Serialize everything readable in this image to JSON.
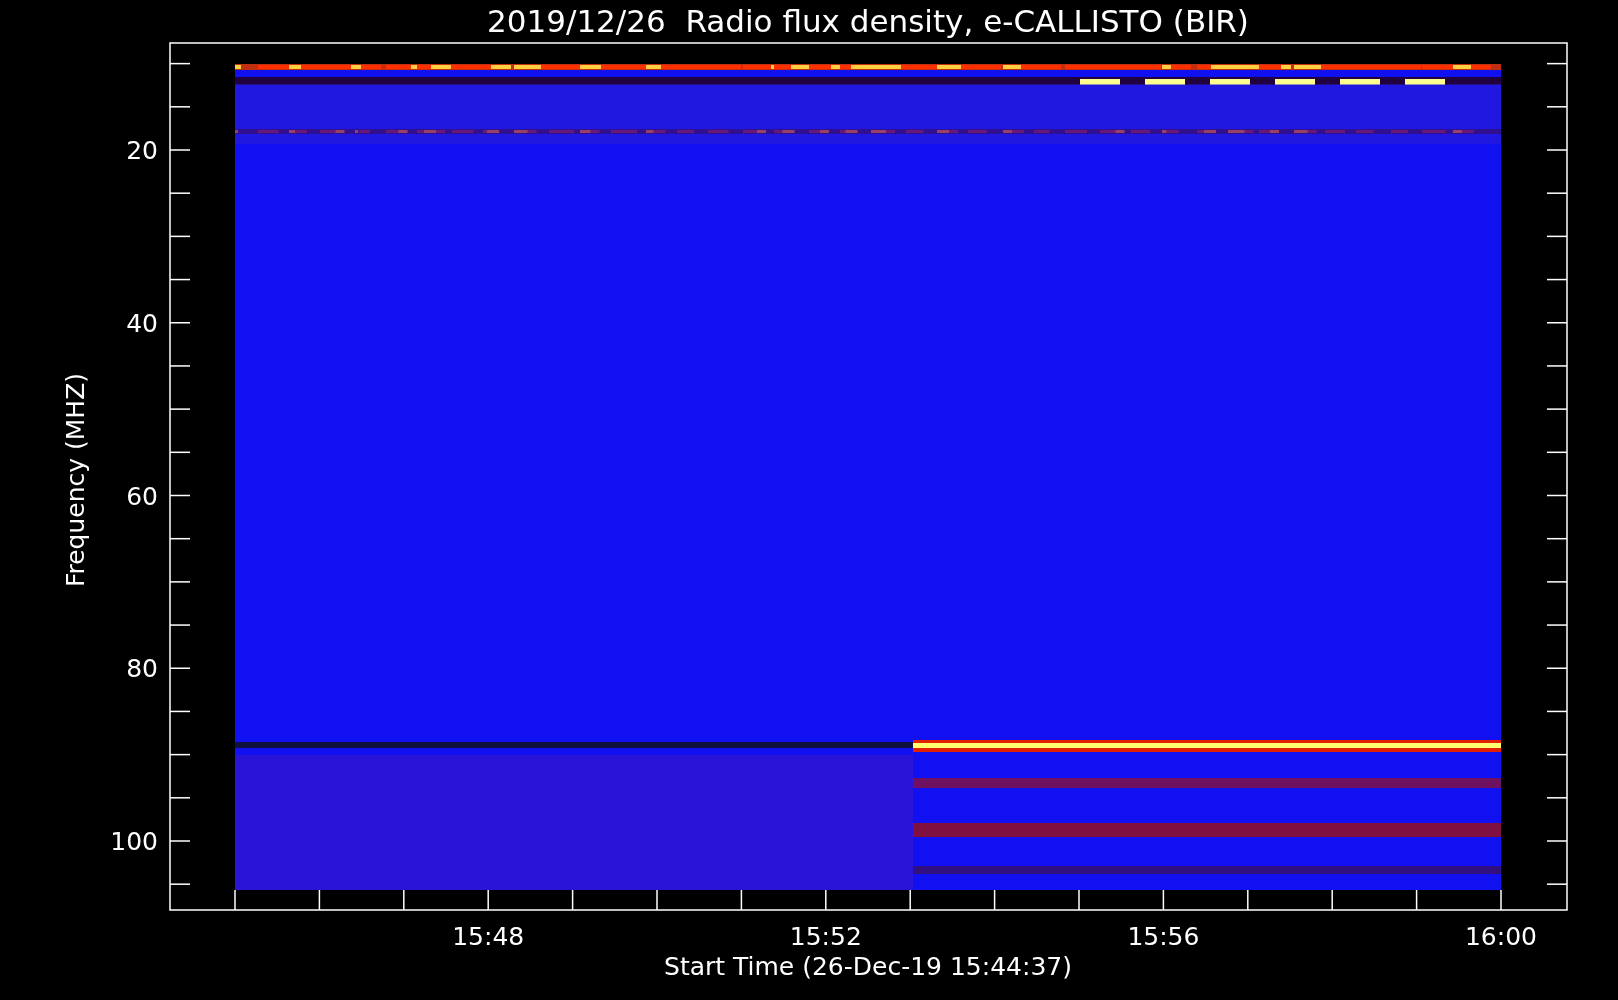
{
  "title": "2019/12/26  Radio flux density, e-CALLISTO (BIR)",
  "plot": {
    "ylabel": "Frequency (MHZ)",
    "xlabel": "Start Time (26-Dec-19 15:44:37)",
    "y_tick_labels": [
      "20",
      "40",
      "60",
      "80",
      "100"
    ],
    "x_tick_labels": [
      "15:48",
      "15:52",
      "15:56",
      "16:00"
    ]
  }
}
